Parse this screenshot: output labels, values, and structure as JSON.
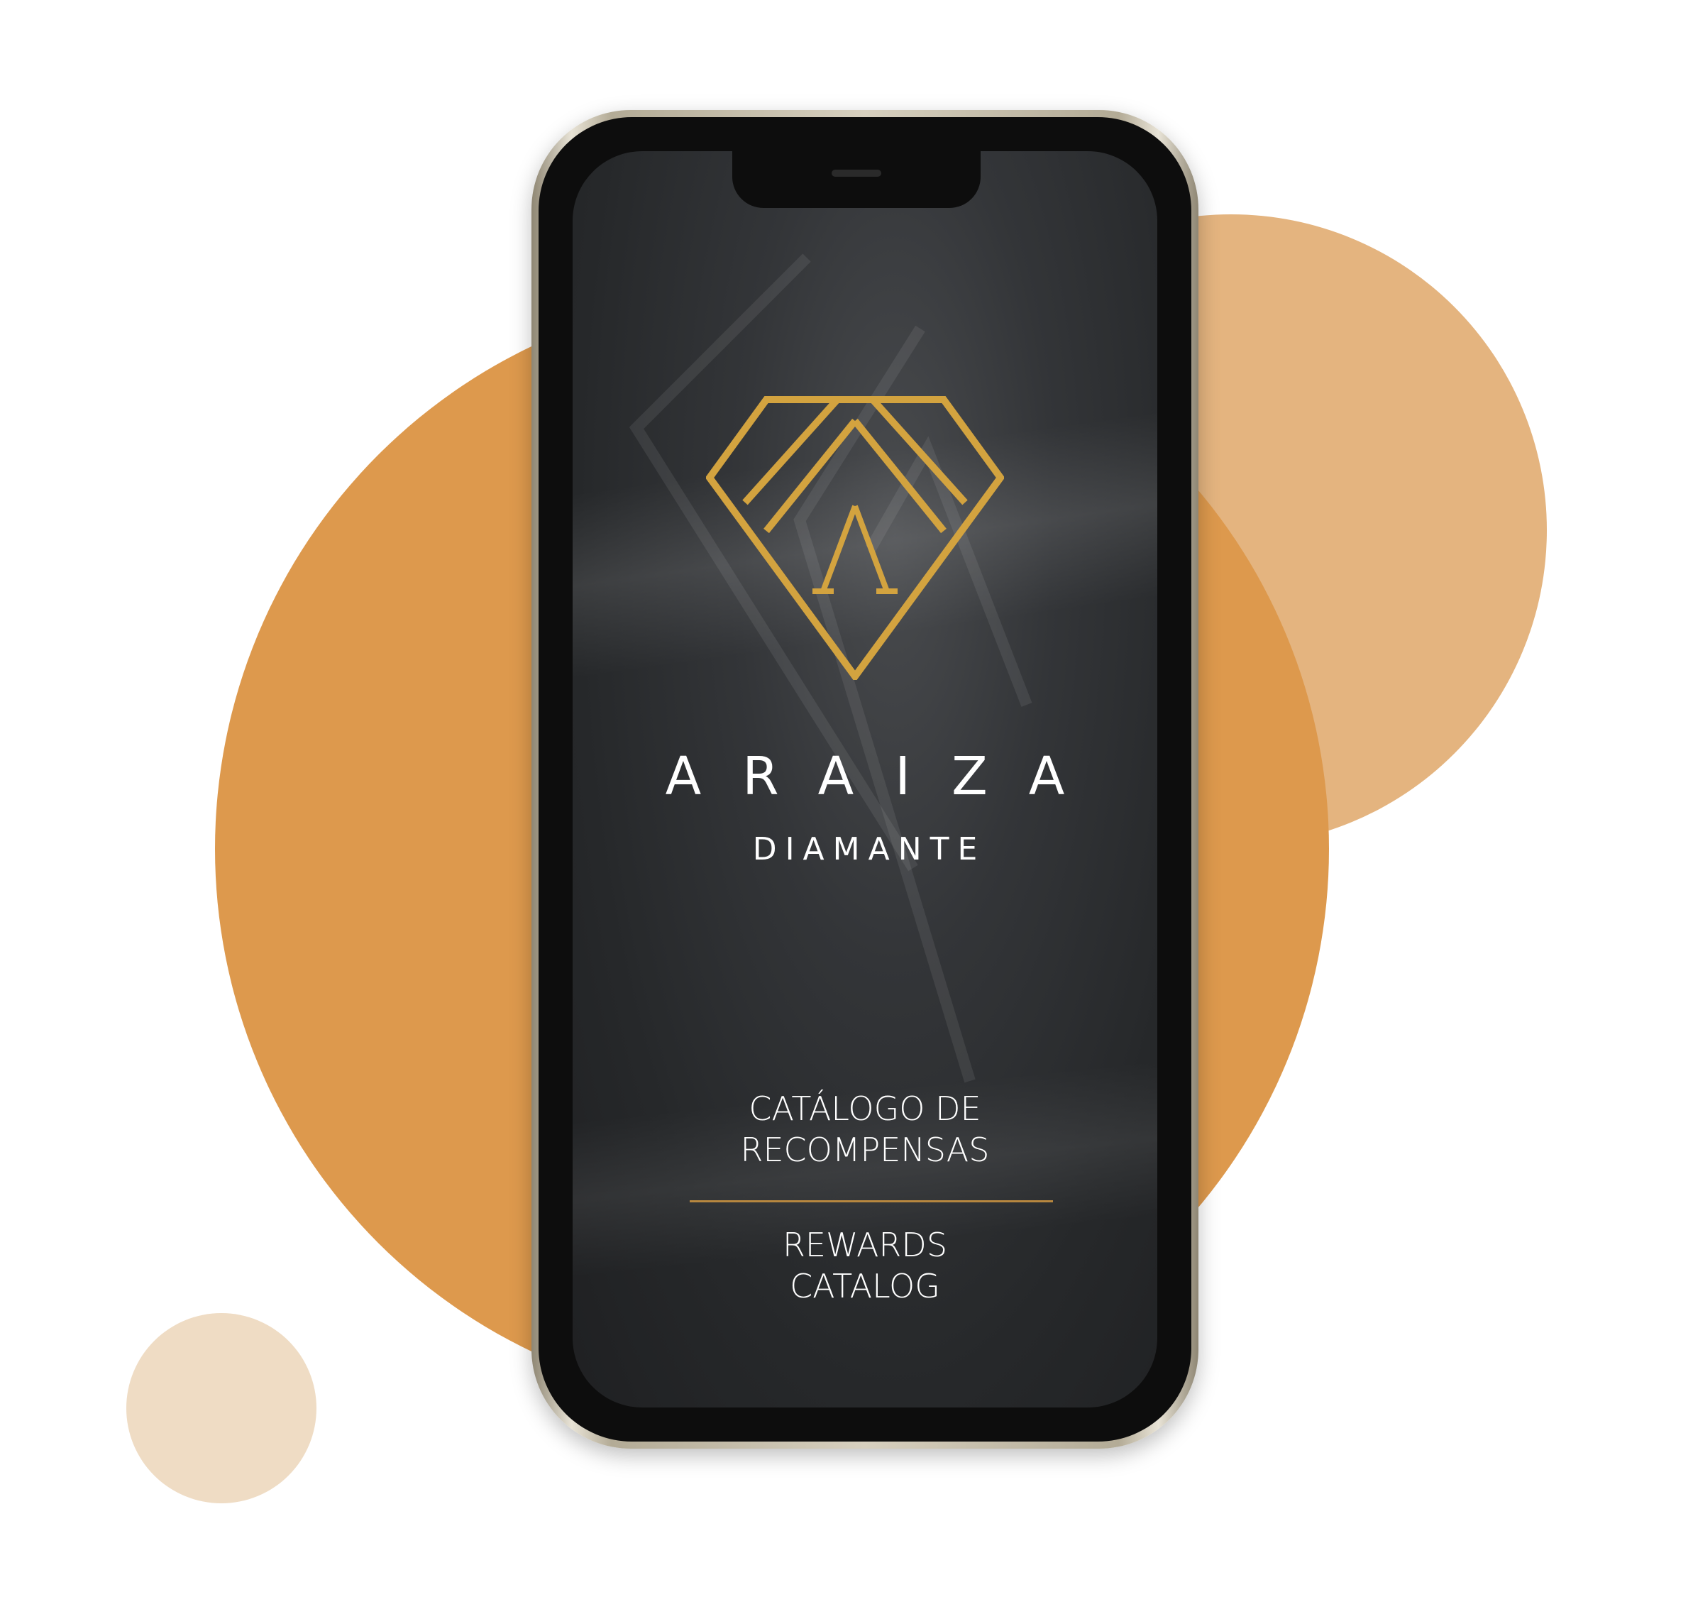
{
  "brand": {
    "name": "ARAIZA",
    "sub": "DIAMANTE",
    "logo_color": "#d3a33f"
  },
  "catalog": {
    "es_line1": "CATÁLOGO DE",
    "es_line2": "RECOMPENSAS",
    "en_line1": "REWARDS",
    "en_line2": "CATALOG",
    "divider_color": "#b7873f"
  },
  "colors": {
    "bubble_main": "#dd994d",
    "bubble_right": "#e4b47f",
    "bubble_small": "#efdcc4",
    "screen_bg": "#2b2d30"
  }
}
